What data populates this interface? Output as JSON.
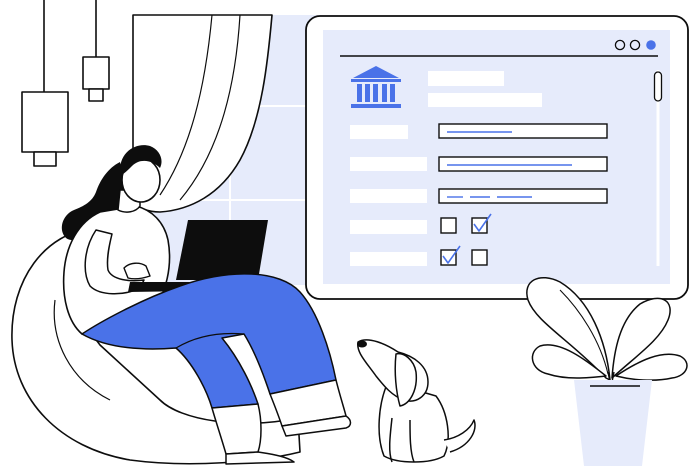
{
  "colors": {
    "accent": "#4a72e8",
    "pale": "#e6ebfb",
    "ink": "#0d0d0d",
    "paper": "#ffffff"
  },
  "window_controls": [
    "circle-outline-icon",
    "circle-outline-icon",
    "circle-filled-icon"
  ],
  "form": {
    "logo": "bank-building-icon",
    "rows": 5,
    "text_inputs": 3,
    "checkboxes": [
      false,
      true,
      true,
      false
    ]
  }
}
